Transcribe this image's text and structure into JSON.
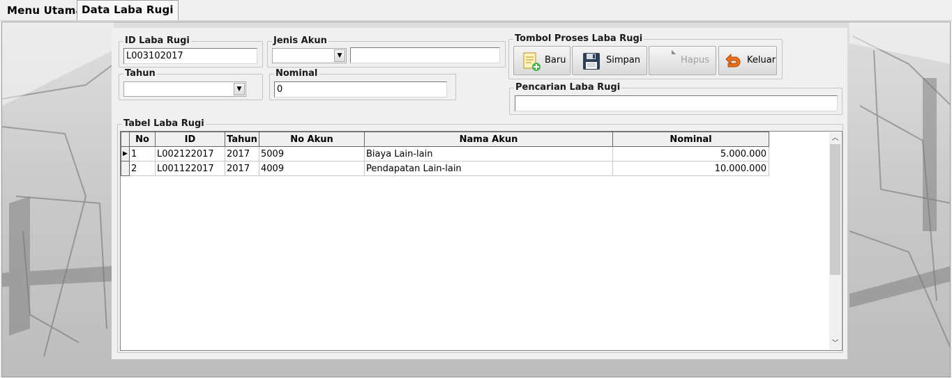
{
  "tabs": [
    {
      "label": "Menu Utama"
    },
    {
      "label": "Data Laba Rugi"
    }
  ],
  "form": {
    "id_group_title": "ID Laba Rugi",
    "id_value": "L003102017",
    "jenis_group_title": "Jenis Akun",
    "jenis_value": "",
    "jenis_name_value": "",
    "tahun_group_title": "Tahun",
    "tahun_value": "",
    "nominal_group_title": "Nominal",
    "nominal_value": "0"
  },
  "actions": {
    "group_title": "Tombol Proses Laba Rugi",
    "baru": "Baru",
    "simpan": "Simpan",
    "hapus": "Hapus",
    "keluar": "Keluar"
  },
  "search": {
    "group_title": "Pencarian Laba Rugi",
    "value": ""
  },
  "table": {
    "group_title": "Tabel Laba Rugi",
    "columns": [
      "No",
      "ID",
      "Tahun",
      "No Akun",
      "Nama Akun",
      "Nominal"
    ],
    "rows": [
      {
        "no": "1",
        "id": "L002122017",
        "tahun": "2017",
        "no_akun": "5009",
        "nama_akun": "Biaya Lain-lain",
        "nominal": "5.000.000"
      },
      {
        "no": "2",
        "id": "L001122017",
        "tahun": "2017",
        "no_akun": "4009",
        "nama_akun": "Pendapatan Lain-lain",
        "nominal": "10.000.000"
      }
    ]
  },
  "icons": {
    "baru": "new-document-icon",
    "simpan": "floppy-disk-icon",
    "hapus": "delete-icon",
    "keluar": "exit-arrow-icon"
  },
  "colors": {
    "keluar_icon": "#e8701a",
    "baru_icon": "#4caf50"
  }
}
